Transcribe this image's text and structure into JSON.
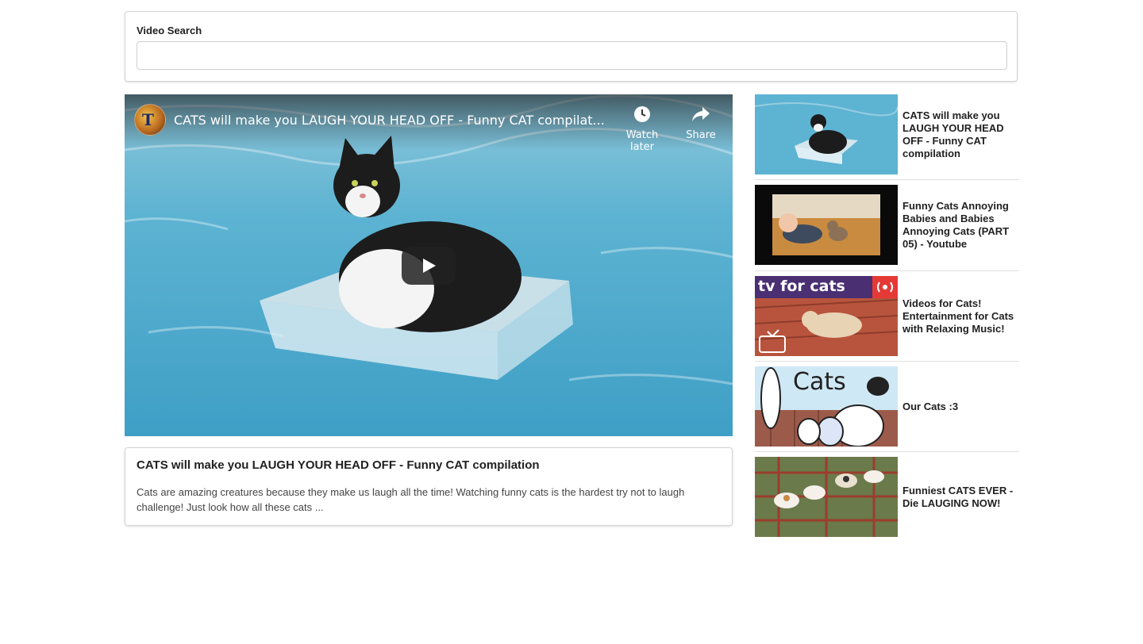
{
  "search": {
    "label": "Video Search",
    "value": "",
    "placeholder": ""
  },
  "player": {
    "title": "CATS will make you LAUGH YOUR HEAD OFF - Funny CAT compilat...",
    "watch_later_label": "Watch later",
    "share_label": "Share"
  },
  "detail": {
    "title": "CATS will make you LAUGH YOUR HEAD OFF - Funny CAT compilation",
    "description": "Cats are amazing creatures because they make us laugh all the time! Watching funny cats is the hardest try not to laugh challenge! Just look how all these cats ..."
  },
  "videos": [
    {
      "title": "CATS will make you LAUGH YOUR HEAD OFF - Funny CAT compilation"
    },
    {
      "title": "Funny Cats Annoying Babies and Babies Annoying Cats (PART 05) - Youtube"
    },
    {
      "title": "Videos for Cats! Entertainment for Cats with Relaxing Music!",
      "thumb_text": "tv for cats"
    },
    {
      "title": "Our Cats :3",
      "thumb_text": "Cats"
    },
    {
      "title": "Funniest CATS EVER - Die LAUGING NOW!"
    }
  ],
  "colors": {
    "play_button": "#212121",
    "water": "#4aa6c9",
    "live_badge": "#e53935"
  }
}
